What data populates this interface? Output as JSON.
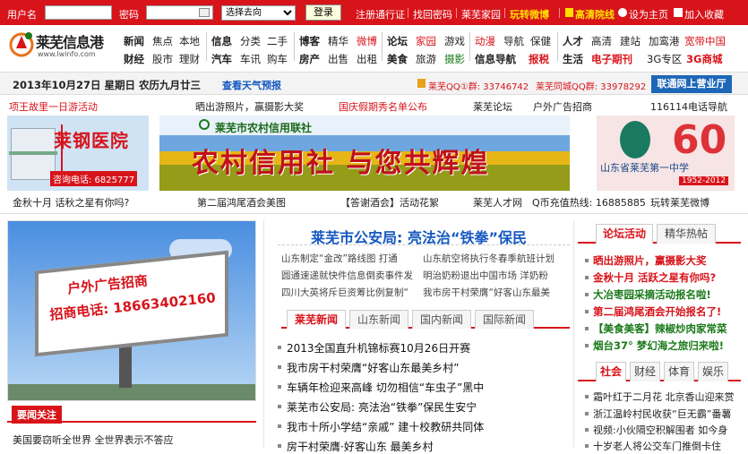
{
  "topbar": {
    "username_label": "用户名",
    "password_label": "密码",
    "goto_select": "选择去向",
    "login_button": "登录",
    "links": [
      "注册通行证",
      "找回密码",
      "莱芜家园"
    ],
    "weibo": "玩转微博",
    "hd": "高清院线",
    "homepage": "设为主页",
    "favorite": "加入收藏"
  },
  "logo": {
    "name": "莱芜信息港",
    "url": "www.lwinfo.com"
  },
  "nav": {
    "row1": [
      "新闻",
      "焦点",
      "本地",
      "信息",
      "分类",
      "二手",
      "博客",
      "精华",
      "微博",
      "论坛",
      "家园",
      "游戏",
      "动漫",
      "导航",
      "保健",
      "人才",
      "高清",
      "建站",
      "加鸾港",
      "宽带中国"
    ],
    "row2": [
      "财经",
      "股市",
      "理财",
      "汽车",
      "车讯",
      "购车",
      "房产",
      "出售",
      "出租",
      "美食",
      "旅游",
      "摄影",
      "信息导航",
      "报税",
      "生活",
      "电子期刊",
      "3G专区",
      "3G商城"
    ]
  },
  "datebar": {
    "date": "2013年10月27日  星期日  农历九月廿三",
    "weather": "查看天气预报",
    "qq1": "莱芜QQ①群: 33746742",
    "qq2": "莱芜同城QQ群: 33978292",
    "service": "联通网上营业厅"
  },
  "text_row": [
    {
      "t": "项王故里一日游活动",
      "red": true
    },
    {
      "t": "晒出游照片，赢摄影大奖",
      "red": false
    },
    {
      "t": "国庆假期秀名单公布",
      "red": true
    },
    {
      "t": "莱芜论坛",
      "red": false
    },
    {
      "t": "户外广告招商",
      "red": false
    },
    {
      "t": "116114电话导航",
      "red": false
    }
  ],
  "ads": {
    "hospital": "莱钢医院",
    "hospital_sub": "咨询电话: 6825777",
    "bank_org": "莱芜市农村信用联社",
    "bank_slogan": "农村信用社  与您共辉煌",
    "school": "山东省莱芜第一中学",
    "school_years": "1952-2012"
  },
  "caption_row": [
    "金秋十月 话秋之星有你吗?",
    "第二届鸿尾酒会美图",
    "【答谢酒会】活动花絮",
    "莱芜人才网",
    "Q币充值热线: 16885885",
    "玩转莱芜微博"
  ],
  "billboard": {
    "line1": "户外广告招商",
    "line2": "招商电话: 18663402160"
  },
  "left_tab": "要闻关注",
  "left_news": [
    "美国要窃听全世界 全世界表示不答应"
  ],
  "headline": "莱芜市公安局: 亮法治“铁拳”保民",
  "sublinks": [
    [
      "山东制定“金改”路线图 打通",
      "山东航空将执行冬春季航班计划"
    ],
    [
      "圆通速递就快件信息倒卖事件发",
      "明治奶粉退出中国市场 洋奶粉"
    ],
    [
      "四川大英将斥巨资筹比例复制“",
      "我市房干村荣膺“好客山东最美"
    ]
  ],
  "mid_tabs": [
    "莱芜新闻",
    "山东新闻",
    "国内新闻",
    "国际新闻"
  ],
  "mid_news": [
    "2013全国直升机锦标赛10月26日开赛",
    "我市房干村荣膺“好客山东最美乡村”",
    "车辆年检迎来高峰 切勿相信“车虫子”黑中",
    "莱芜市公安局: 亮法治“铁拳”保民生安宁",
    "我市十所小学结“亲戚” 建十校教研共同体",
    "房干村荣膺·好客山东 最美乡村"
  ],
  "right_tabs1": [
    "论坛活动",
    "精华热帖"
  ],
  "right_news1": [
    {
      "t": "晒出游照片，赢摄影大奖",
      "c": "#d8141b"
    },
    {
      "t": "金秋十月 活跃之星有你吗?",
      "c": "#d8141b"
    },
    {
      "t": "大冶枣园采摘活动报名啦!",
      "c": "#1a7a1a"
    },
    {
      "t": "第二届鸿尾酒会开始报名了!",
      "c": "#d8141b"
    },
    {
      "t": "【美食美客】辣椒炒肉家常菜",
      "c": "#1a7a1a"
    },
    {
      "t": "烟台37° 梦幻海之旅归来啦!",
      "c": "#1a7a1a"
    }
  ],
  "right_tabs2": [
    "社会",
    "财经",
    "体育",
    "娱乐"
  ],
  "right_news2": [
    "霜叶红于二月花 北京香山迎来赏",
    "浙江温岭村民收获“巨无霸”番薯",
    "视频:小伙隔空积解围者 如今身",
    "十岁老人将公交车门推倒卡住"
  ]
}
